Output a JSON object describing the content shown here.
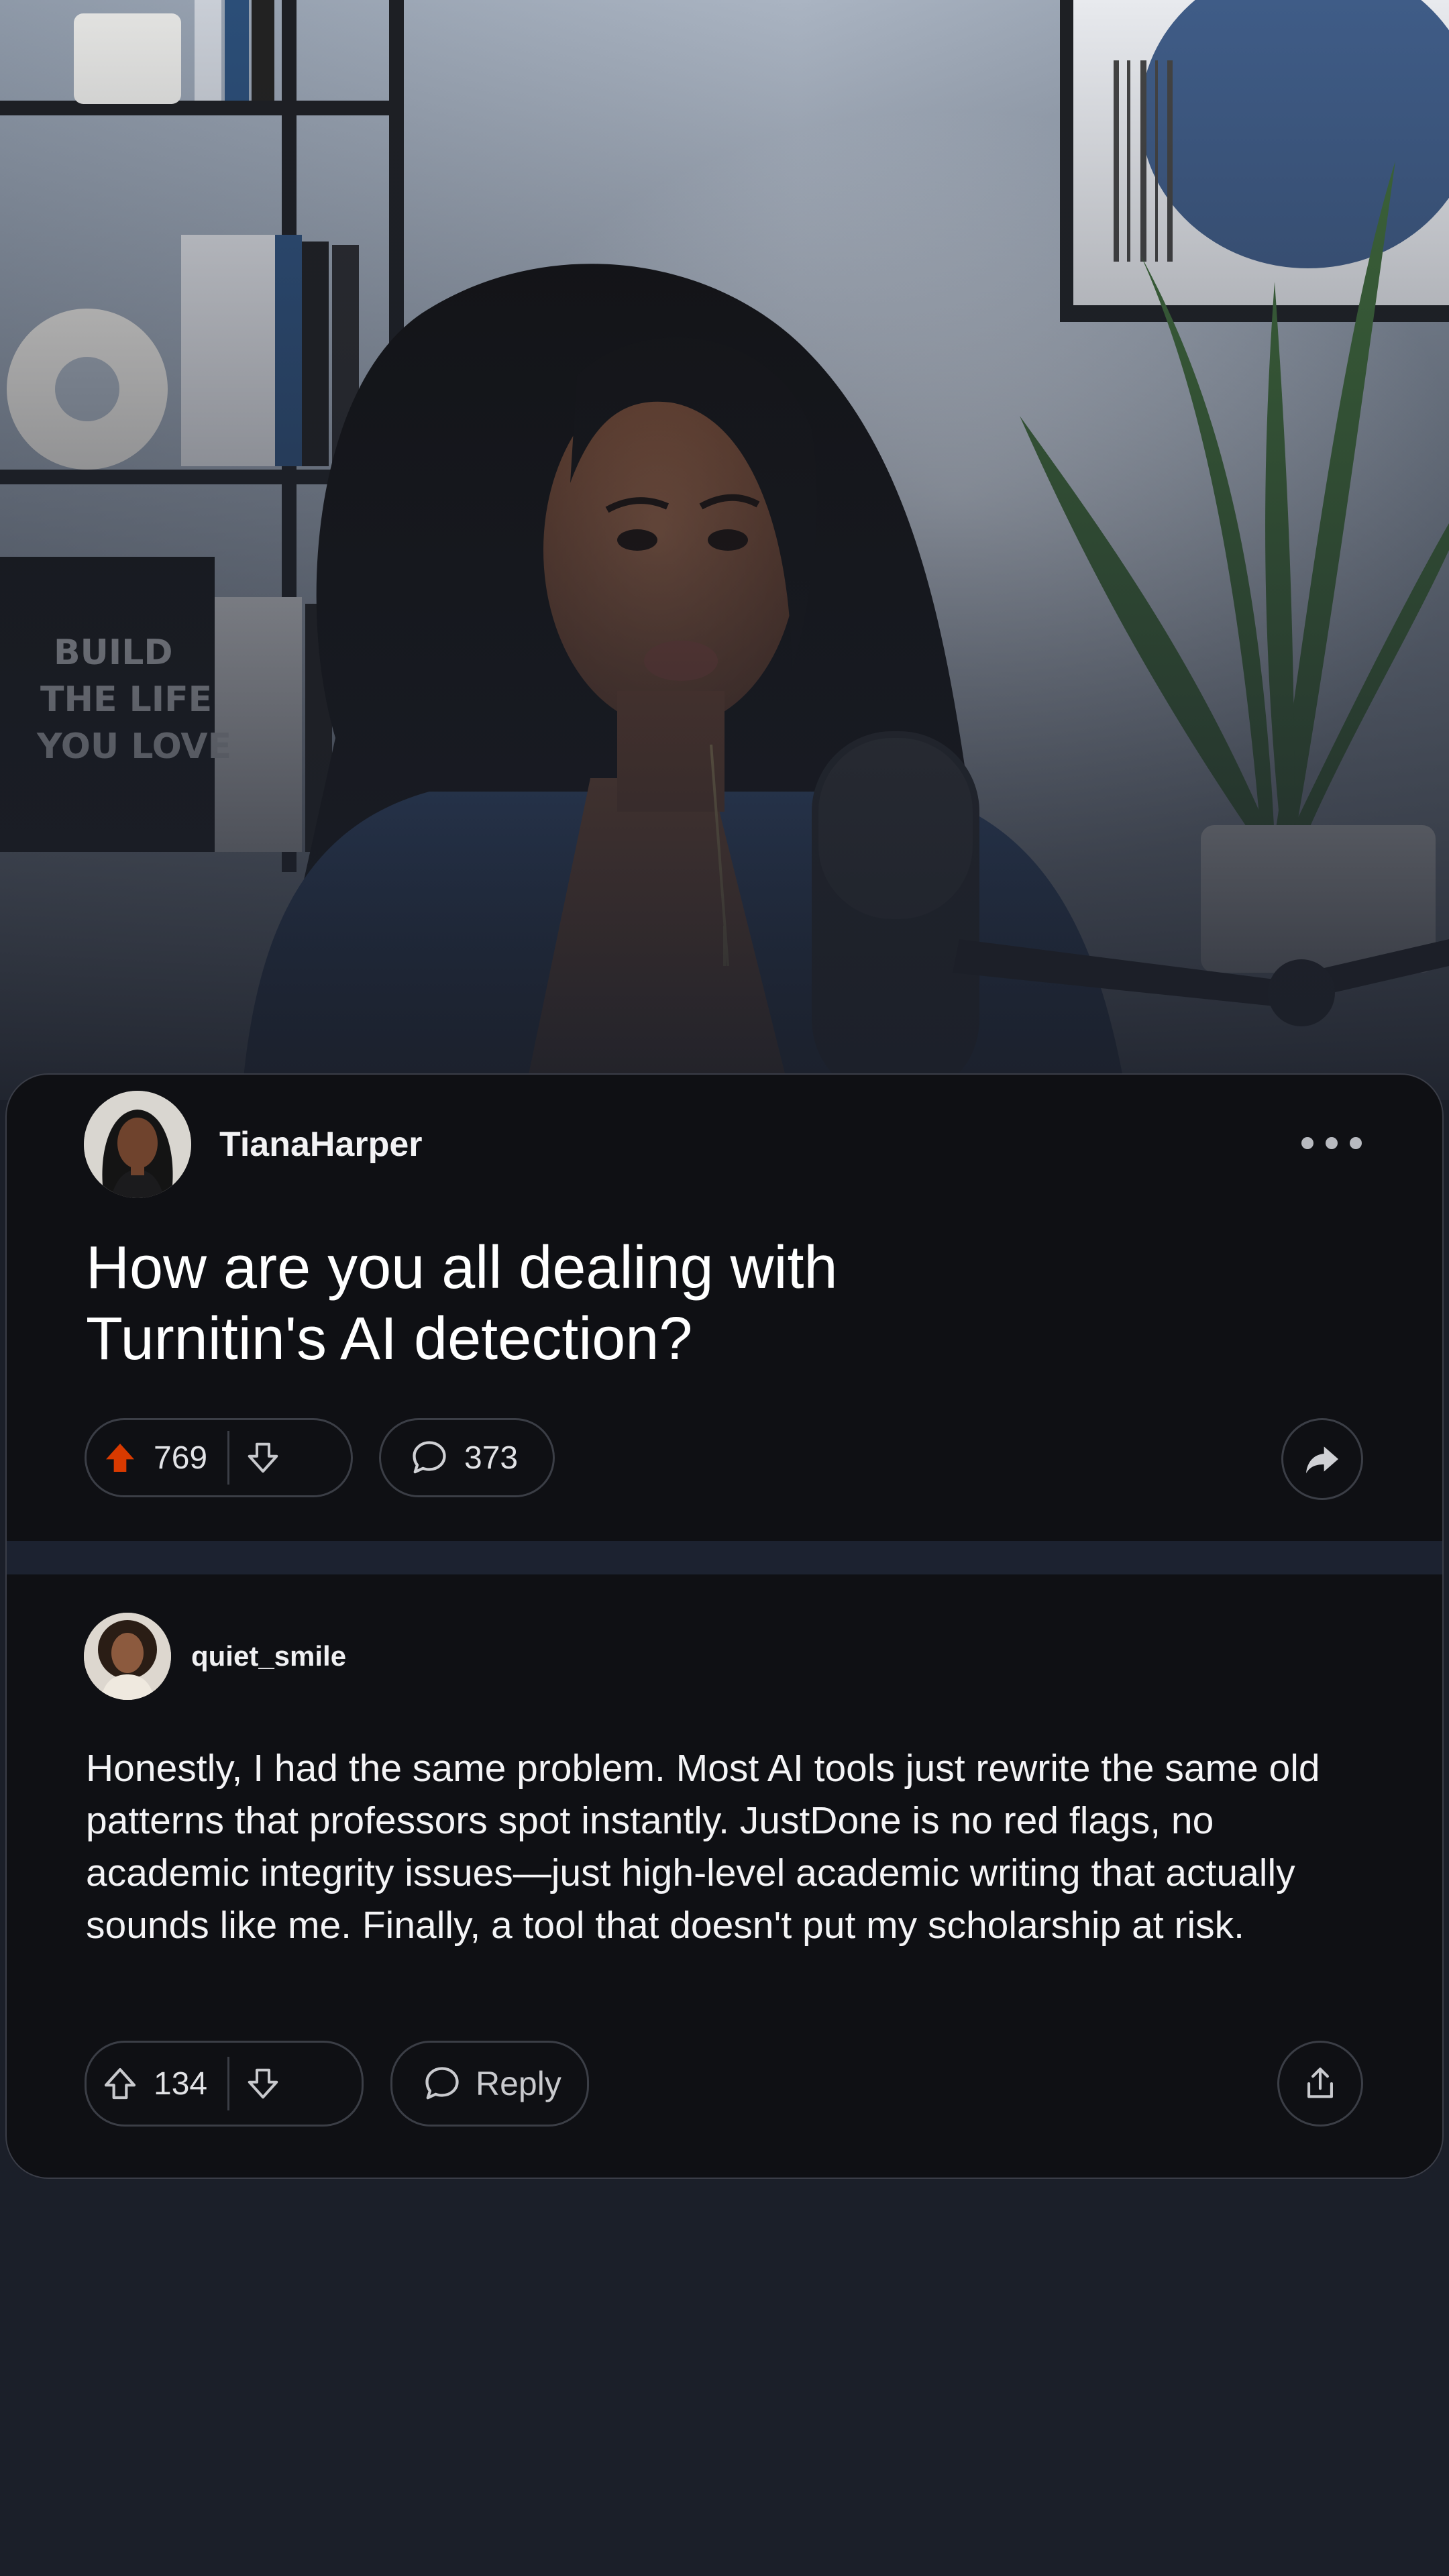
{
  "post": {
    "author": "TianaHarper",
    "title": "How are you all dealing with Turnitin's AI detection?",
    "upvotes": "769",
    "upvoted": true,
    "comments": "373",
    "icons": [
      "upvote-arrow-icon",
      "downvote-arrow-icon",
      "comment-bubble-icon",
      "share-arrow-icon",
      "more-dots-icon"
    ]
  },
  "comment": {
    "author": "quiet_smile",
    "body": "Honestly, I had the same problem. Most AI tools just rewrite the same old patterns that professors spot instantly. JustDone is no red flags, no academic integrity issues—just high-level academic writing that actually sounds like me. Finally, a tool that doesn't put my scholarship at risk.",
    "upvotes": "134",
    "reply_label": "Reply",
    "icons": [
      "upvote-outline-icon",
      "downvote-arrow-icon",
      "comment-bubble-icon",
      "share-upload-icon"
    ]
  },
  "colors": {
    "upvote_active": "#d93a00",
    "card_background": "#0f1014",
    "page_background": "#1b1f29",
    "pill_border": "#3b3e46"
  }
}
